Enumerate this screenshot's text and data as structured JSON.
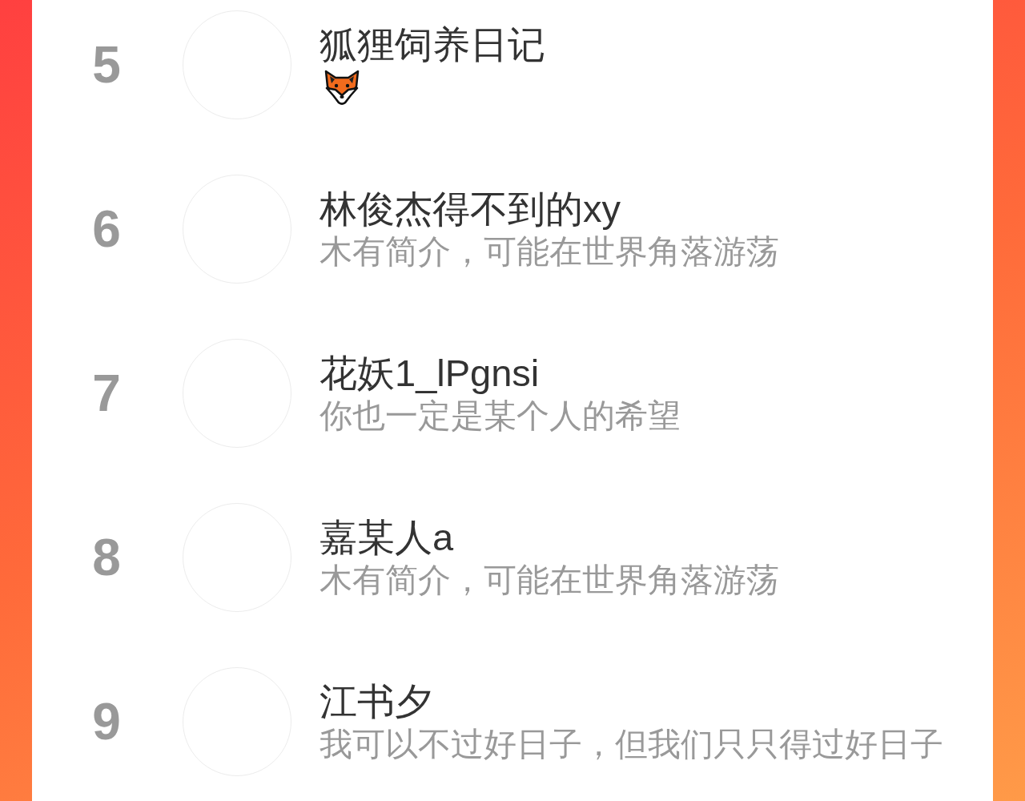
{
  "ranking": {
    "rows": [
      {
        "rank": "5",
        "name": "狐狸饲养日记",
        "kind": "emoji_bio"
      },
      {
        "rank": "6",
        "name": "林俊杰得不到的xy",
        "kind": "text_bio",
        "bio": "木有简介，可能在世界角落游荡"
      },
      {
        "rank": "7",
        "name": "花妖1_lPgnsi",
        "kind": "text_bio",
        "bio": "你也一定是某个人的希望"
      },
      {
        "rank": "8",
        "name": "嘉某人a",
        "kind": "text_bio",
        "bio": "木有简介，可能在世界角落游荡"
      },
      {
        "rank": "9",
        "name": "江书夕",
        "kind": "text_bio",
        "bio": "我可以不过好日子，但我们只只得过好日子"
      }
    ]
  }
}
